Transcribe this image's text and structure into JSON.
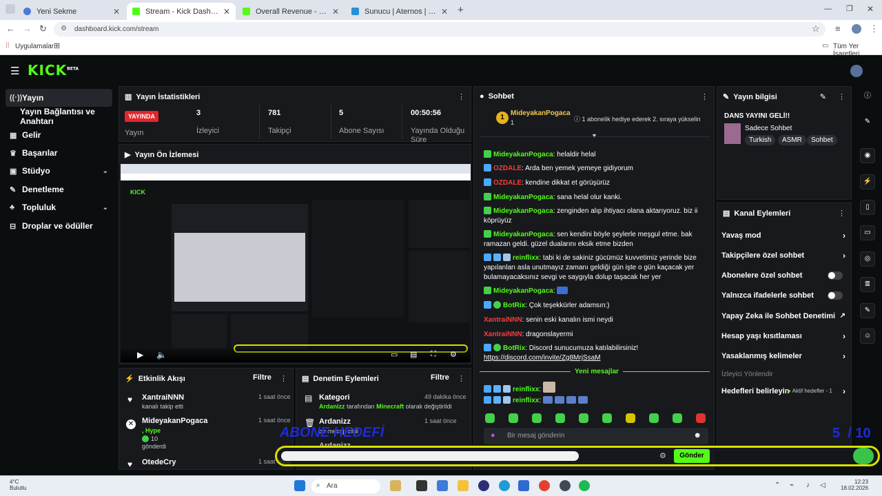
{
  "browser": {
    "tabs": [
      {
        "title": "Yeni Sekme",
        "color": "#4a7bd8"
      },
      {
        "title": "Stream - Kick Dashboard",
        "color": "#53fc18"
      },
      {
        "title": "Overall Revenue - Kick Dashbo...",
        "color": "#53fc18"
      },
      {
        "title": "Sunucu | Aternos | Ücretsiz Min...",
        "color": "#2a8fd6"
      }
    ],
    "url": "dashboard.kick.com/stream",
    "bookmarks_left": "Uygulamalar",
    "bookmarks_right": "Tüm Yer İşaretleri"
  },
  "kick": {
    "logo": "KICK",
    "logo_beta": "BETA",
    "sidebar": [
      {
        "label": "Yayın",
        "icon": "broadcast-icon"
      },
      {
        "label": "Yayın Bağlantısı ve Anahtarı",
        "icon": ""
      },
      {
        "label": "Gelir",
        "icon": "revenue-icon"
      },
      {
        "label": "Başarılar",
        "icon": "trophy-icon"
      },
      {
        "label": "Stüdyo",
        "icon": "studio-icon",
        "chevron": "⌄"
      },
      {
        "label": "Denetleme",
        "icon": "wrench-icon"
      },
      {
        "label": "Topluluk",
        "icon": "community-icon",
        "chevron": "⌄"
      },
      {
        "label": "Droplar ve ödüller",
        "icon": "gift-icon"
      }
    ],
    "stats": {
      "title": "Yayın İstatistikleri",
      "live": "YAYINDA",
      "live_label": "Yayın",
      "items": [
        {
          "value": "3",
          "label": "İzleyici"
        },
        {
          "value": "781",
          "label": "Takipçi"
        },
        {
          "value": "5",
          "label": "Abone Sayısı"
        },
        {
          "value": "00:50:56",
          "label": "Yayında Olduğu Süre"
        }
      ]
    },
    "preview": {
      "title": "Yayın Ön İzlemesi",
      "kick_logo": "KICK"
    },
    "activity": {
      "title": "Etkinlik Akışı",
      "filter": "Filtre",
      "items": [
        {
          "name": "XantraiNNN",
          "sub": "kanalı takip etti",
          "time": "1 saat önce"
        },
        {
          "name": "MideyakanPogaca",
          "sub": ", Hype",
          "extra": "10",
          "sub2": "gönderdi",
          "time": "1 saat önce"
        },
        {
          "name": "OtedeCry",
          "sub": "",
          "time": "1 saat önce"
        }
      ]
    },
    "moderation": {
      "title": "Denetim Eylemleri",
      "filter": "Filtre",
      "items": [
        {
          "title": "Kategori",
          "time": "49 dakika önce",
          "actor": "Ardanizz",
          "mid": "tarafından",
          "cat": "Minecraft",
          "end": "olarak değiştirildi"
        },
        {
          "title": "Ardanizz",
          "time": "1 saat önce",
          "sub": "bir mesajı sildi"
        },
        {
          "title": "Ardanizz",
          "time": "1 saat önce",
          "sub": ""
        }
      ]
    },
    "chat": {
      "title": "Sohbet",
      "top_user": "MideyakanPogaca",
      "top_count": "1",
      "gift_note": "1 abonelik hediye ederek 2. sıraya yükselin",
      "lines": [
        {
          "user": "MideyakanPogaca",
          "color": "g",
          "text": "helaldir helal"
        },
        {
          "user": "OZDALE",
          "color": "r",
          "text": "Arda ben yemek yemeye gidiyorum"
        },
        {
          "user": "OZDALE",
          "color": "r",
          "text": "kendine dikkat et görüşürüz"
        },
        {
          "user": "MideyakanPogaca",
          "color": "g",
          "text": "sana helal olur kanki."
        },
        {
          "user": "MideyakanPogaca",
          "color": "g",
          "text": "zenginden alıp ihtiyacı olana aktarıyoruz. biz ii köprüyüz"
        },
        {
          "user": "MideyakanPogaca",
          "color": "g",
          "text": "sen kendini böyle şeylerle meşgul etme. bak ramazan geldi. güzel dualarını eksik etme bizden"
        },
        {
          "user": "reinflixx",
          "color": "g",
          "text": "tabi ki de sakiniz gücümüz kuvvetimiz yerinde bize yapılanları asla unutmayız zamanı geldiği gün işte o gün kaçacak yer bulamayacaksınız sevgi ve saygıyla dolup taşacak her yer"
        },
        {
          "user": "MideyakanPogaca",
          "color": "g",
          "text": ""
        },
        {
          "user": "BotRix",
          "color": "g",
          "text": "Çok teşekkürler adamsın:)"
        },
        {
          "user": "XantraiNNN",
          "color": "r",
          "text": "senin eski kanalın ismi neydi"
        },
        {
          "user": "XantraiNNN",
          "color": "r",
          "text": "dragonslayermi"
        },
        {
          "user": "BotRix",
          "color": "g",
          "text": "Discord sunucumuza katılabilirsiniz!"
        },
        {
          "user": "reinflixx",
          "color": "g",
          "text": ""
        },
        {
          "user": "reinflixx",
          "color": "g",
          "text": ""
        }
      ],
      "discord_link": "https://discord.com/invite/Zg8MrjSsaM",
      "new_messages": "Yeni mesajlar",
      "input_placeholder": "Bir mesaj gönderin",
      "send": "Gönder"
    },
    "stream_info": {
      "title": "Yayın bilgisi",
      "stream_title": "DANS YAYINI GELİ!!",
      "category": "Sadece Sohbet",
      "tags": [
        "Turkish",
        "ASMR",
        "Sohbet"
      ]
    },
    "channel_actions": {
      "title": "Kanal Eylemleri",
      "items": [
        {
          "label": "Yavaş mod",
          "ctrl": "arrow"
        },
        {
          "label": "Takipçilere özel sohbet",
          "ctrl": "arrow"
        },
        {
          "label": "Abonelere özel sohbet",
          "ctrl": "toggle"
        },
        {
          "label": "Yalnızca ifadelerle sohbet",
          "ctrl": "toggle"
        },
        {
          "label": "Yapay Zeka ile Sohbet Denetimi",
          "ctrl": "ext"
        },
        {
          "label": "Hesap yaşı kısıtlaması",
          "ctrl": "arrow"
        },
        {
          "label": "Yasaklanmış kelimeler",
          "ctrl": "arrow"
        }
      ],
      "redirect_label": "İzleyici Yönlendir",
      "goals_label": "Hedefleri belirleyin",
      "goals_status": "Aktif hedefler - 1"
    },
    "overlay": {
      "sub_goal": "ABONE HEDEFİ",
      "sub_count": "5  / 10"
    }
  },
  "taskbar": {
    "weather_temp": "4°C",
    "weather_text": "Bulutlu",
    "search": "Ara",
    "time": "12:23",
    "date": "18.02.2026"
  }
}
